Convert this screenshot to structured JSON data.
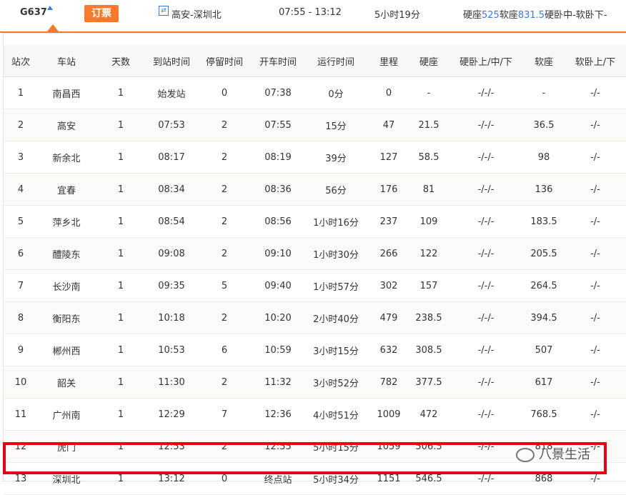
{
  "header": {
    "train_no": "G637",
    "book_label": "订票",
    "route": "高安-深圳北",
    "time_range": "07:55 - 13:12",
    "duration": "5小时19分",
    "prices": [
      {
        "label": "硬座",
        "value": "525"
      },
      {
        "label": "软座",
        "value": "831.5"
      },
      {
        "label": "硬卧中-软卧下-",
        "value": ""
      }
    ]
  },
  "table": {
    "columns": [
      "站次",
      "车站",
      "天数",
      "到站时间",
      "停留时间",
      "开车时间",
      "运行时间",
      "里程",
      "硬座",
      "硬卧上/中/下",
      "软座",
      "软卧上/下"
    ],
    "rows": [
      [
        "1",
        "南昌西",
        "1",
        "始发站",
        "0",
        "07:38",
        "0分",
        "0",
        "-",
        "-/-/-",
        "-",
        "-/-"
      ],
      [
        "2",
        "高安",
        "1",
        "07:53",
        "2",
        "07:55",
        "15分",
        "47",
        "21.5",
        "-/-/-",
        "36.5",
        "-/-"
      ],
      [
        "3",
        "新余北",
        "1",
        "08:17",
        "2",
        "08:19",
        "39分",
        "127",
        "58.5",
        "-/-/-",
        "98",
        "-/-"
      ],
      [
        "4",
        "宜春",
        "1",
        "08:34",
        "2",
        "08:36",
        "56分",
        "176",
        "81",
        "-/-/-",
        "136",
        "-/-"
      ],
      [
        "5",
        "萍乡北",
        "1",
        "08:54",
        "2",
        "08:56",
        "1小时16分",
        "237",
        "109",
        "-/-/-",
        "183.5",
        "-/-"
      ],
      [
        "6",
        "醴陵东",
        "1",
        "09:08",
        "2",
        "09:10",
        "1小时30分",
        "266",
        "122",
        "-/-/-",
        "205.5",
        "-/-"
      ],
      [
        "7",
        "长沙南",
        "1",
        "09:35",
        "5",
        "09:40",
        "1小时57分",
        "302",
        "157",
        "-/-/-",
        "264.5",
        "-/-"
      ],
      [
        "8",
        "衡阳东",
        "1",
        "10:18",
        "2",
        "10:20",
        "2小时40分",
        "479",
        "238.5",
        "-/-/-",
        "394.5",
        "-/-"
      ],
      [
        "9",
        "郴州西",
        "1",
        "10:53",
        "6",
        "10:59",
        "3小时15分",
        "632",
        "308.5",
        "-/-/-",
        "507",
        "-/-"
      ],
      [
        "10",
        "韶关",
        "1",
        "11:30",
        "2",
        "11:32",
        "3小时52分",
        "782",
        "377.5",
        "-/-/-",
        "617",
        "-/-"
      ],
      [
        "11",
        "广州南",
        "1",
        "12:29",
        "7",
        "12:36",
        "4小时51分",
        "1009",
        "472",
        "-/-/-",
        "768.5",
        "-/-"
      ],
      [
        "12",
        "虎门",
        "1",
        "12:53",
        "2",
        "12:55",
        "5小时15分",
        "1059",
        "506.5",
        "-/-/-",
        "818",
        "-/-"
      ],
      [
        "13",
        "深圳北",
        "1",
        "13:12",
        "0",
        "终点站",
        "5小时34分",
        "1151",
        "546.5",
        "-/-/-",
        "868",
        "-/-"
      ]
    ]
  },
  "watermark": "八景生活",
  "colors": {
    "accent": "#f77a2b",
    "highlight": "#e60012",
    "link": "#3a7bd5"
  }
}
